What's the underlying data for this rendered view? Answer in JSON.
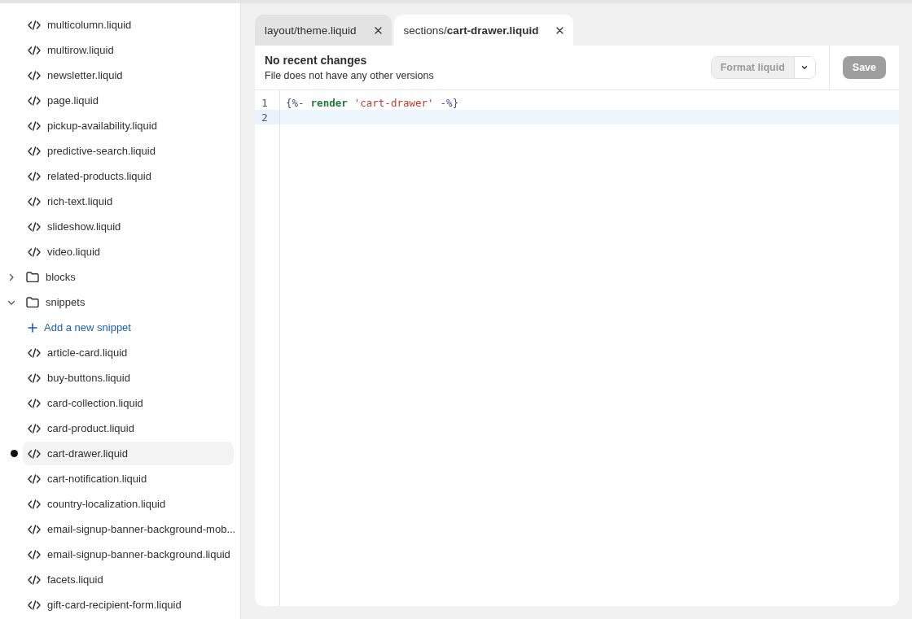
{
  "sidebar": {
    "items": [
      {
        "kind": "file",
        "label": "multicolumn.liquid",
        "selected": false
      },
      {
        "kind": "file",
        "label": "multirow.liquid",
        "selected": false
      },
      {
        "kind": "file",
        "label": "newsletter.liquid",
        "selected": false
      },
      {
        "kind": "file",
        "label": "page.liquid",
        "selected": false
      },
      {
        "kind": "file",
        "label": "pickup-availability.liquid",
        "selected": false
      },
      {
        "kind": "file",
        "label": "predictive-search.liquid",
        "selected": false
      },
      {
        "kind": "file",
        "label": "related-products.liquid",
        "selected": false
      },
      {
        "kind": "file",
        "label": "rich-text.liquid",
        "selected": false
      },
      {
        "kind": "file",
        "label": "slideshow.liquid",
        "selected": false
      },
      {
        "kind": "file",
        "label": "video.liquid",
        "selected": false
      },
      {
        "kind": "folder",
        "label": "blocks",
        "expanded": false
      },
      {
        "kind": "folder",
        "label": "snippets",
        "expanded": true
      },
      {
        "kind": "add",
        "label": "Add a new snippet"
      },
      {
        "kind": "file",
        "label": "article-card.liquid",
        "selected": false
      },
      {
        "kind": "file",
        "label": "buy-buttons.liquid",
        "selected": false
      },
      {
        "kind": "file",
        "label": "card-collection.liquid",
        "selected": false
      },
      {
        "kind": "file",
        "label": "card-product.liquid",
        "selected": false
      },
      {
        "kind": "file",
        "label": "cart-drawer.liquid",
        "selected": true
      },
      {
        "kind": "file",
        "label": "cart-notification.liquid",
        "selected": false
      },
      {
        "kind": "file",
        "label": "country-localization.liquid",
        "selected": false
      },
      {
        "kind": "file",
        "label": "email-signup-banner-background-mob...",
        "selected": false
      },
      {
        "kind": "file",
        "label": "email-signup-banner-background.liquid",
        "selected": false
      },
      {
        "kind": "file",
        "label": "facets.liquid",
        "selected": false
      },
      {
        "kind": "file",
        "label": "gift-card-recipient-form.liquid",
        "selected": false
      }
    ]
  },
  "tabs": [
    {
      "label": "layout/theme.liquid",
      "selected": false
    },
    {
      "label": "sections/**cart-drawer.liquid**",
      "selected": true
    }
  ],
  "editor": {
    "title": "No recent changes",
    "subtitle": "File does not have any other versions",
    "format_button": "Format liquid",
    "save_button": "Save",
    "save_disabled": true,
    "lines": [
      {
        "number": "1",
        "current": false,
        "tokens": [
          {
            "kind": "delim",
            "text": "{%-"
          },
          {
            "kind": "keyword",
            "text": "render"
          },
          {
            "kind": "string",
            "text": "'cart-drawer'"
          },
          {
            "kind": "delim",
            "text": "-%}"
          }
        ]
      },
      {
        "number": "2",
        "current": true
      }
    ]
  }
}
